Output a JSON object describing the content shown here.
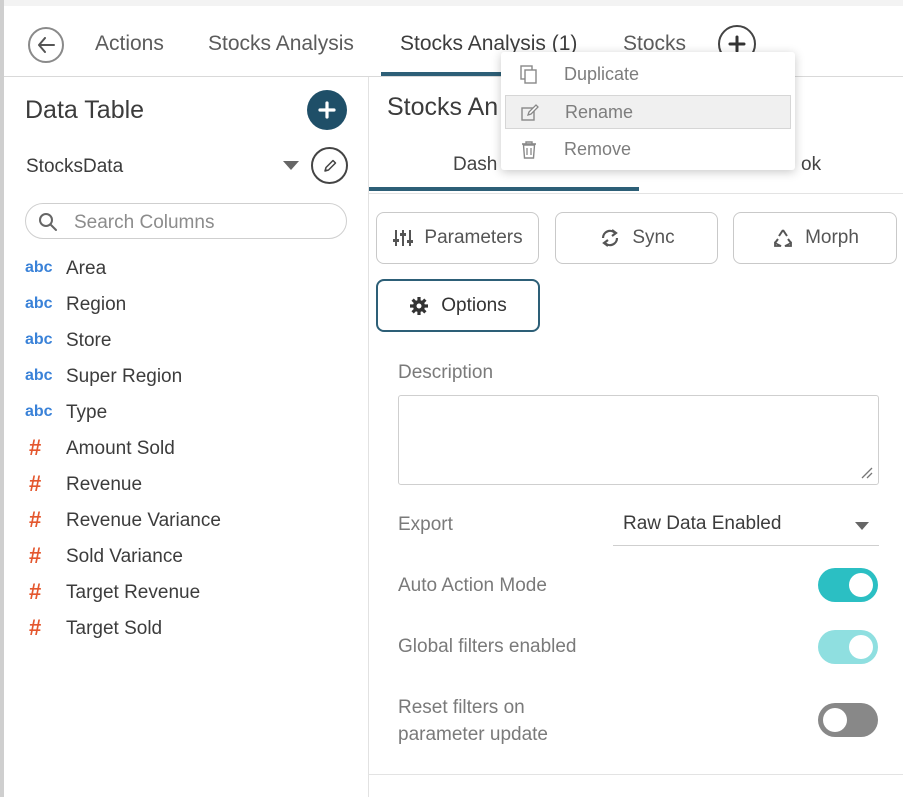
{
  "tabs": [
    {
      "label": "Actions"
    },
    {
      "label": "Stocks Analysis"
    },
    {
      "label": "Stocks Analysis (1)"
    },
    {
      "label": "Stocks"
    }
  ],
  "left_panel": {
    "title": "Data Table",
    "datasource": "StocksData",
    "search": {
      "placeholder": "Search Columns",
      "value": ""
    },
    "columns": [
      {
        "type": "abc",
        "name": "Area"
      },
      {
        "type": "abc",
        "name": "Region"
      },
      {
        "type": "abc",
        "name": "Store"
      },
      {
        "type": "abc",
        "name": "Super Region"
      },
      {
        "type": "abc",
        "name": "Type"
      },
      {
        "type": "#",
        "name": "Amount Sold"
      },
      {
        "type": "#",
        "name": "Revenue"
      },
      {
        "type": "#",
        "name": "Revenue Variance"
      },
      {
        "type": "#",
        "name": "Sold Variance"
      },
      {
        "type": "#",
        "name": "Target Revenue"
      },
      {
        "type": "#",
        "name": "Target Sold"
      }
    ]
  },
  "dashboard": {
    "title": "Stocks An",
    "subtabs": [
      {
        "label": "Dash"
      },
      {
        "label": "ok"
      }
    ],
    "buttons": {
      "parameters": "Parameters",
      "sync": "Sync",
      "morph": "Morph",
      "options": "Options"
    },
    "form": {
      "description_label": "Description",
      "description_value": "",
      "export_label": "Export",
      "export_value": "Raw Data Enabled",
      "auto_action_label": "Auto Action Mode",
      "auto_action_on": true,
      "global_filters_label": "Global filters enabled",
      "global_filters_on": true,
      "reset_filters_label_line1": "Reset filters on",
      "reset_filters_label_line2": "parameter update",
      "reset_filters_on": false
    }
  },
  "context_menu": {
    "items": [
      {
        "label": "Duplicate",
        "icon": "duplicate-icon"
      },
      {
        "label": "Rename",
        "icon": "rename-icon",
        "highlighted": true
      },
      {
        "label": "Remove",
        "icon": "trash-icon"
      }
    ]
  },
  "colors": {
    "accent": "#2d5f77",
    "toggle_on": "#2bbfc3",
    "toggle_off": "#888888",
    "abc_type": "#3a82d8",
    "number_type": "#e4572e"
  }
}
